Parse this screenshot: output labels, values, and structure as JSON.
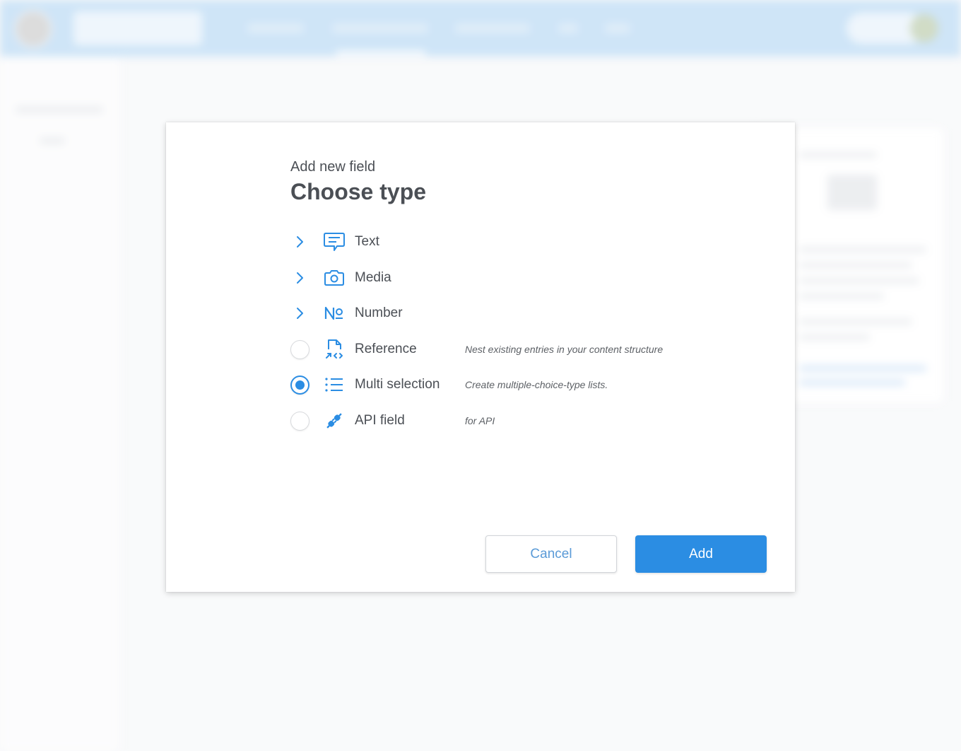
{
  "modal": {
    "subtitle": "Add new field",
    "title": "Choose type",
    "types": [
      {
        "label": "Text",
        "control": "expand",
        "icon": "text-bubble-icon",
        "description": ""
      },
      {
        "label": "Media",
        "control": "expand",
        "icon": "camera-icon",
        "description": ""
      },
      {
        "label": "Number",
        "control": "expand",
        "icon": "number-sign-icon",
        "description": ""
      },
      {
        "label": "Reference",
        "control": "radio",
        "selected": false,
        "icon": "reference-file-icon",
        "description": "Nest existing entries in your content structure"
      },
      {
        "label": "Multi selection",
        "control": "radio",
        "selected": true,
        "icon": "list-icon",
        "description": "Create multiple-choice-type lists."
      },
      {
        "label": "API field",
        "control": "radio",
        "selected": false,
        "icon": "plug-icon",
        "description": "for API"
      }
    ],
    "cancel_label": "Cancel",
    "add_label": "Add"
  },
  "colors": {
    "accent": "#2b8de3",
    "topbar": "#b5d7f3",
    "text": "#4b4f55"
  }
}
